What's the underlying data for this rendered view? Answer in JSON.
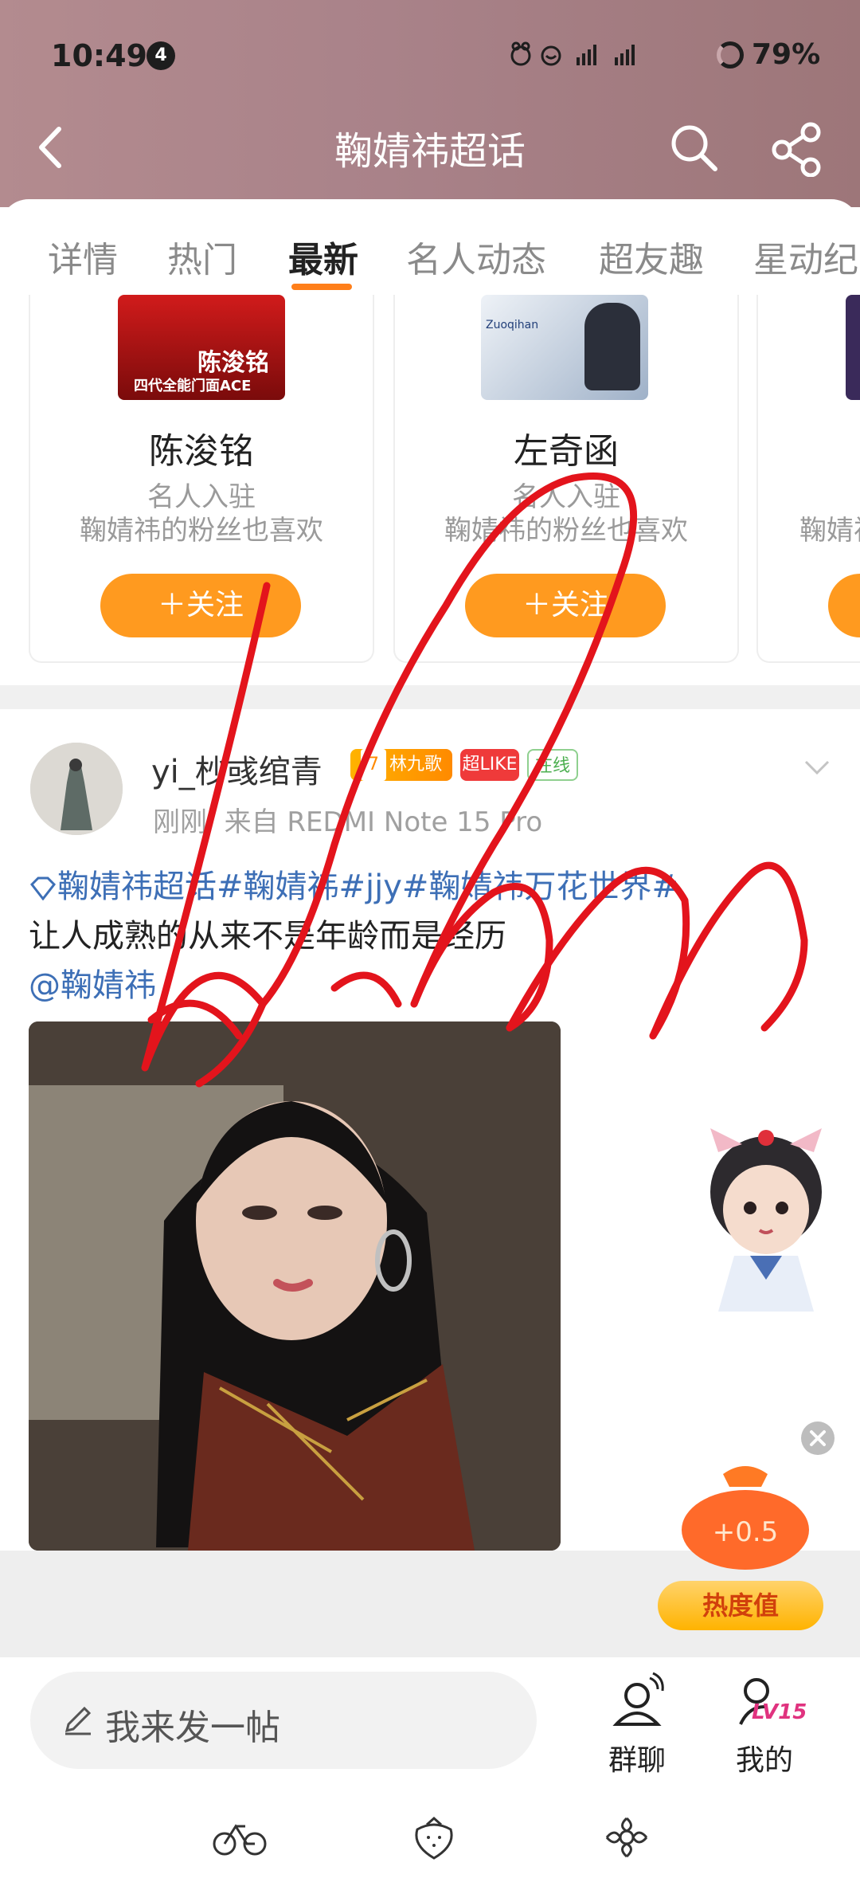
{
  "status_bar": {
    "time": "10:49",
    "notification_count": "4",
    "battery": "79%"
  },
  "header": {
    "title": "鞠婧祎超话"
  },
  "tabs": [
    {
      "label": "详情"
    },
    {
      "label": "热门"
    },
    {
      "label": "最新"
    },
    {
      "label": "名人动态"
    },
    {
      "label": "超友趣"
    },
    {
      "label": "星动纪"
    }
  ],
  "recommend": [
    {
      "name": "陈浚铭",
      "sub1": "名人入驻",
      "sub2": "鞠婧祎的粉丝也喜欢",
      "follow": "＋关注",
      "img_text": "陈浚铭",
      "img_caption": "四代全能门面ACE"
    },
    {
      "name": "左奇函",
      "sub1": "名人入驻",
      "sub2": "鞠婧祎的粉丝也喜欢",
      "follow": "＋关注",
      "img_text": "Zuoqihan"
    },
    {
      "sub2": "鞠婧祎"
    }
  ],
  "post": {
    "username": "yi_杪彧绾青",
    "badges": [
      "林九歌",
      "超LIKE",
      "在线"
    ],
    "badge_level": "7",
    "time": "刚刚",
    "from": "来自 REDMI Note 15 Pro",
    "tags": "鞠婧祎超话#鞠婧祎#jjy#鞠婧祎万花世界#",
    "text": "让人成熟的从来不是年龄而是经历",
    "mention": "@鞠婧祎"
  },
  "reward": {
    "amount": "+0.5",
    "label": "热度值"
  },
  "bottom": {
    "post_placeholder": "我来发一帖",
    "chat_label": "群聊",
    "me_label": "我的",
    "level": "LV15"
  },
  "colors": {
    "accent": "#ff9a1f",
    "link": "#3d6fb6",
    "header": "#a98289",
    "scribble": "#e3141c"
  }
}
